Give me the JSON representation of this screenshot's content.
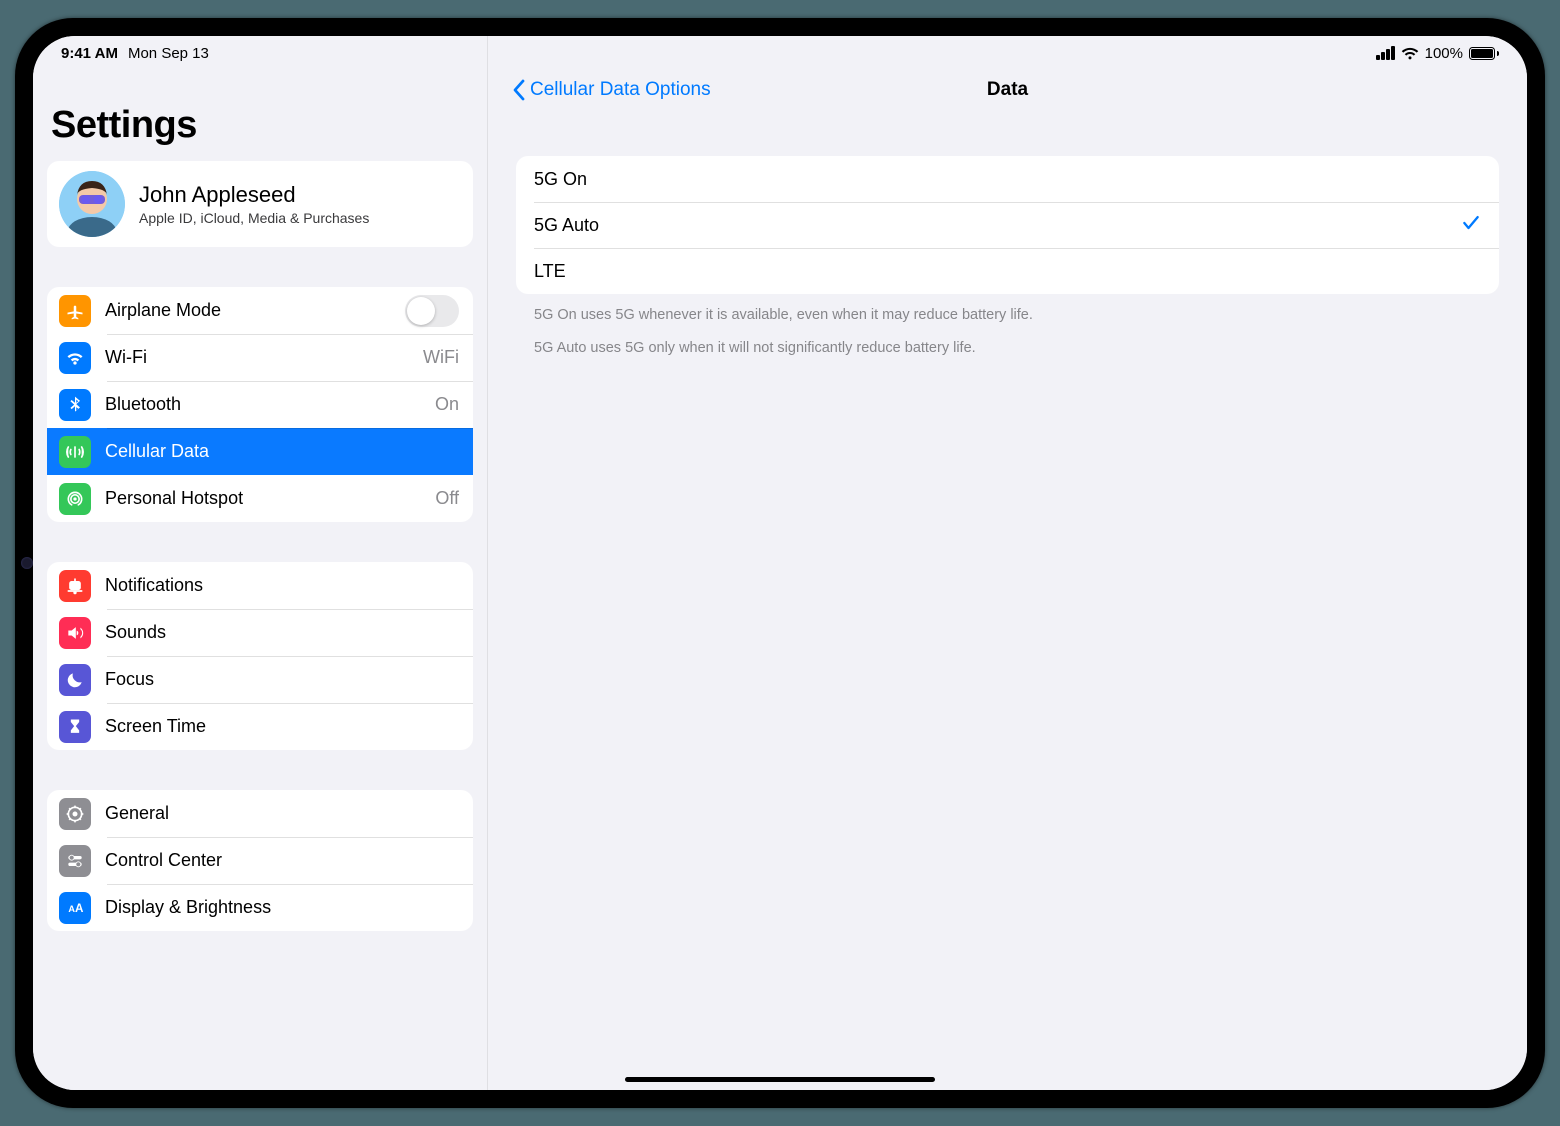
{
  "status": {
    "time": "9:41 AM",
    "date": "Mon Sep 13",
    "battery_pct": "100%"
  },
  "sidebar": {
    "title": "Settings",
    "profile": {
      "name": "John Appleseed",
      "sub": "Apple ID, iCloud, Media & Purchases"
    },
    "groups": [
      {
        "id": "connectivity",
        "items": [
          {
            "id": "airplane",
            "label": "Airplane Mode",
            "icon": "airplane-icon",
            "iconBg": "#ff9500",
            "type": "toggle",
            "toggle": false
          },
          {
            "id": "wifi",
            "label": "Wi-Fi",
            "icon": "wifi-icon",
            "iconBg": "#007aff",
            "type": "value",
            "value": "WiFi"
          },
          {
            "id": "bluetooth",
            "label": "Bluetooth",
            "icon": "bluetooth-icon",
            "iconBg": "#007aff",
            "type": "value",
            "value": "On"
          },
          {
            "id": "cellular",
            "label": "Cellular Data",
            "icon": "cellular-icon",
            "iconBg": "#34c759",
            "type": "drill",
            "selected": true
          },
          {
            "id": "hotspot",
            "label": "Personal Hotspot",
            "icon": "hotspot-icon",
            "iconBg": "#34c759",
            "type": "value",
            "value": "Off"
          }
        ]
      },
      {
        "id": "notifications",
        "items": [
          {
            "id": "notifications",
            "label": "Notifications",
            "icon": "bell-icon",
            "iconBg": "#ff3b30",
            "type": "drill"
          },
          {
            "id": "sounds",
            "label": "Sounds",
            "icon": "speaker-icon",
            "iconBg": "#ff2d55",
            "type": "drill"
          },
          {
            "id": "focus",
            "label": "Focus",
            "icon": "moon-icon",
            "iconBg": "#5856d6",
            "type": "drill"
          },
          {
            "id": "screentime",
            "label": "Screen Time",
            "icon": "hourglass-icon",
            "iconBg": "#5856d6",
            "type": "drill"
          }
        ]
      },
      {
        "id": "general",
        "items": [
          {
            "id": "general",
            "label": "General",
            "icon": "gear-icon",
            "iconBg": "#8e8e93",
            "type": "drill"
          },
          {
            "id": "controlcenter",
            "label": "Control Center",
            "icon": "switches-icon",
            "iconBg": "#8e8e93",
            "type": "drill"
          },
          {
            "id": "display",
            "label": "Display & Brightness",
            "icon": "aa-icon",
            "iconBg": "#007aff",
            "type": "drill"
          }
        ]
      }
    ]
  },
  "detail": {
    "back_label": "Cellular Data Options",
    "title": "Data",
    "options": [
      {
        "id": "5g-on",
        "label": "5G On",
        "selected": false
      },
      {
        "id": "5g-auto",
        "label": "5G Auto",
        "selected": true
      },
      {
        "id": "lte",
        "label": "LTE",
        "selected": false
      }
    ],
    "footer": [
      "5G On uses 5G whenever it is available, even when it may reduce battery life.",
      "5G Auto uses 5G only when it will not significantly reduce battery life."
    ]
  }
}
